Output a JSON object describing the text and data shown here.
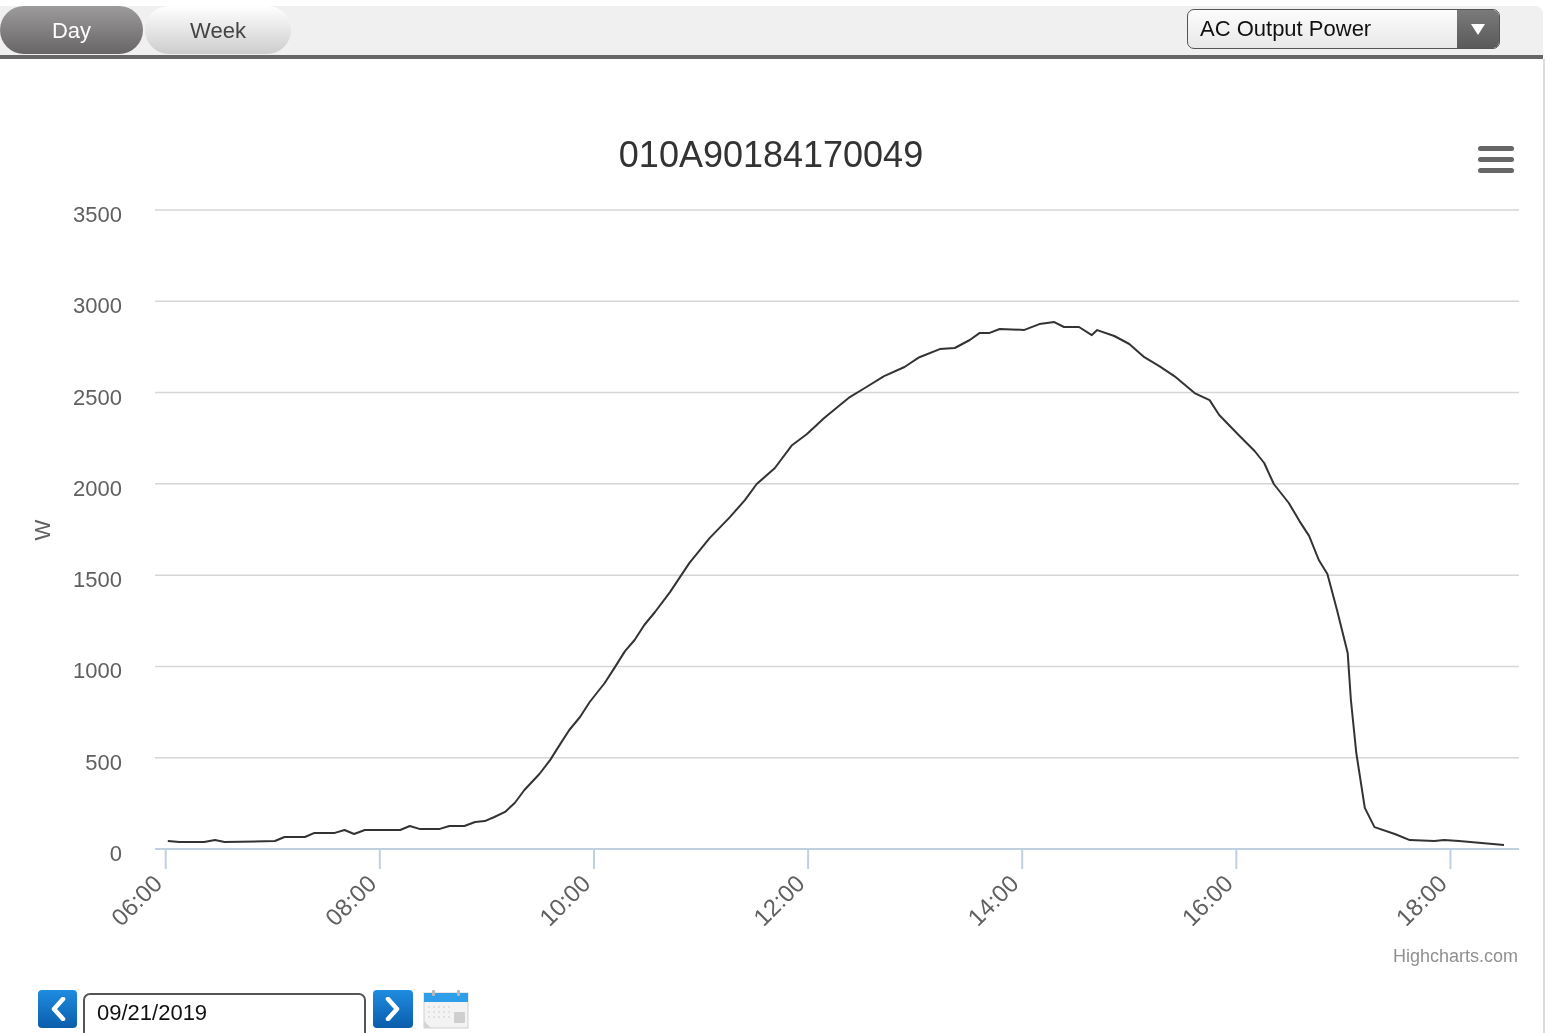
{
  "tabs": [
    {
      "label": "Day",
      "selected": true
    },
    {
      "label": "Week",
      "selected": false
    }
  ],
  "metric_dropdown": {
    "value": "AC Output Power"
  },
  "chart": {
    "chart_data": {
      "type": "line",
      "title": "010A90184170049",
      "ylabel": "W",
      "grid": true,
      "x": [
        6.02,
        6.13,
        6.36,
        6.46,
        6.55,
        7.02,
        7.11,
        7.3,
        7.39,
        7.58,
        7.67,
        7.76,
        7.86,
        8.19,
        8.28,
        8.37,
        8.56,
        8.65,
        8.79,
        8.89,
        8.98,
        9.07,
        9.17,
        9.26,
        9.35,
        9.49,
        9.59,
        9.68,
        9.77,
        9.87,
        9.96,
        10.1,
        10.19,
        10.29,
        10.38,
        10.47,
        10.57,
        10.71,
        10.89,
        11.08,
        11.27,
        11.41,
        11.52,
        11.69,
        11.85,
        11.99,
        12.15,
        12.39,
        12.53,
        12.71,
        12.9,
        13.04,
        13.23,
        13.37,
        13.51,
        13.6,
        13.69,
        13.79,
        14.02,
        14.16,
        14.3,
        14.39,
        14.53,
        14.65,
        14.7,
        14.86,
        15.0,
        15.14,
        15.28,
        15.42,
        15.61,
        15.75,
        15.84,
        16.03,
        16.17,
        16.26,
        16.35,
        16.49,
        16.59,
        16.68,
        16.77,
        16.85,
        16.94,
        17.04,
        17.07,
        17.12,
        17.2,
        17.29,
        17.48,
        17.62,
        17.85,
        17.94,
        18.08,
        18.5
      ],
      "series": [
        {
          "values": [
            44,
            38,
            38,
            49,
            38,
            44,
            66,
            66,
            88,
            88,
            104,
            82,
            104,
            104,
            126,
            110,
            110,
            126,
            126,
            148,
            153,
            175,
            203,
            252,
            323,
            411,
            487,
            570,
            652,
            723,
            805,
            909,
            991,
            1084,
            1145,
            1227,
            1298,
            1407,
            1566,
            1703,
            1818,
            1911,
            1999,
            2087,
            2212,
            2273,
            2360,
            2475,
            2525,
            2590,
            2640,
            2694,
            2738,
            2744,
            2788,
            2826,
            2826,
            2848,
            2843,
            2875,
            2886,
            2859,
            2859,
            2815,
            2842,
            2810,
            2766,
            2694,
            2645,
            2590,
            2497,
            2459,
            2377,
            2262,
            2180,
            2114,
            1999,
            1895,
            1796,
            1714,
            1583,
            1506,
            1309,
            1073,
            816,
            526,
            225,
            120,
            82,
            49,
            44,
            49,
            44,
            22
          ]
        }
      ],
      "xlim": [
        5.9,
        18.64
      ],
      "ylim": [
        0,
        3500
      ],
      "xticks": [
        {
          "value": 6,
          "label": "06:00"
        },
        {
          "value": 8,
          "label": "08:00"
        },
        {
          "value": 10,
          "label": "10:00"
        },
        {
          "value": 12,
          "label": "12:00"
        },
        {
          "value": 14,
          "label": "14:00"
        },
        {
          "value": 16,
          "label": "16:00"
        },
        {
          "value": 18,
          "label": "18:00"
        }
      ],
      "yticks": [
        0,
        500,
        1000,
        1500,
        2000,
        2500,
        3000,
        3500
      ]
    },
    "credits": "Highcharts.com"
  },
  "date_nav": {
    "date": "09/21/2019"
  }
}
